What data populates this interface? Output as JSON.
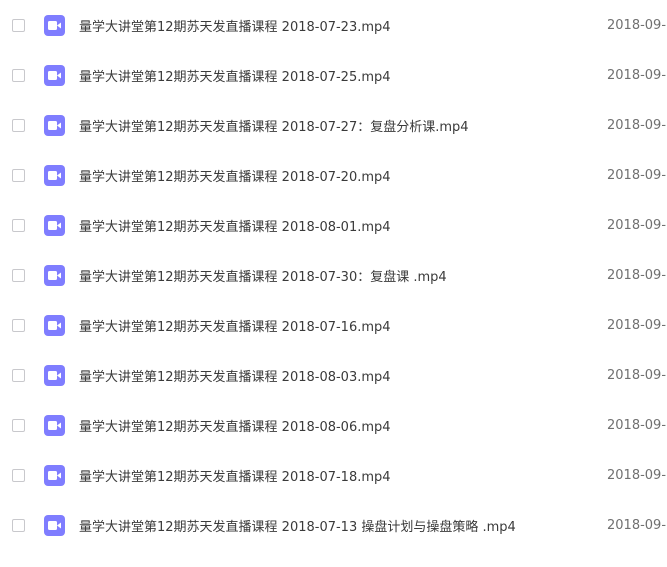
{
  "files": [
    {
      "name": "量学大讲堂第12期苏天发直播课程 2018-07-23.mp4",
      "date": "2018-09-",
      "icon": "video-file-icon"
    },
    {
      "name": "量学大讲堂第12期苏天发直播课程 2018-07-25.mp4",
      "date": "2018-09-",
      "icon": "video-file-icon"
    },
    {
      "name": "量学大讲堂第12期苏天发直播课程 2018-07-27：复盘分析课.mp4",
      "date": "2018-09-",
      "icon": "video-file-icon"
    },
    {
      "name": "量学大讲堂第12期苏天发直播课程 2018-07-20.mp4",
      "date": "2018-09-",
      "icon": "video-file-icon"
    },
    {
      "name": "量学大讲堂第12期苏天发直播课程 2018-08-01.mp4",
      "date": "2018-09-",
      "icon": "video-file-icon"
    },
    {
      "name": "量学大讲堂第12期苏天发直播课程 2018-07-30：复盘课 .mp4",
      "date": "2018-09-",
      "icon": "video-file-icon"
    },
    {
      "name": "量学大讲堂第12期苏天发直播课程 2018-07-16.mp4",
      "date": "2018-09-",
      "icon": "video-file-icon"
    },
    {
      "name": "量学大讲堂第12期苏天发直播课程 2018-08-03.mp4",
      "date": "2018-09-",
      "icon": "video-file-icon"
    },
    {
      "name": "量学大讲堂第12期苏天发直播课程 2018-08-06.mp4",
      "date": "2018-09-",
      "icon": "video-file-icon"
    },
    {
      "name": "量学大讲堂第12期苏天发直播课程 2018-07-18.mp4",
      "date": "2018-09-",
      "icon": "video-file-icon"
    },
    {
      "name": "量学大讲堂第12期苏天发直播课程 2018-07-13 操盘计划与操盘策略 .mp4",
      "date": "2018-09-",
      "icon": "video-file-icon"
    }
  ],
  "colors": {
    "icon_bg": "#7f7dff",
    "text": "#3a3a3a",
    "date": "#707070"
  }
}
